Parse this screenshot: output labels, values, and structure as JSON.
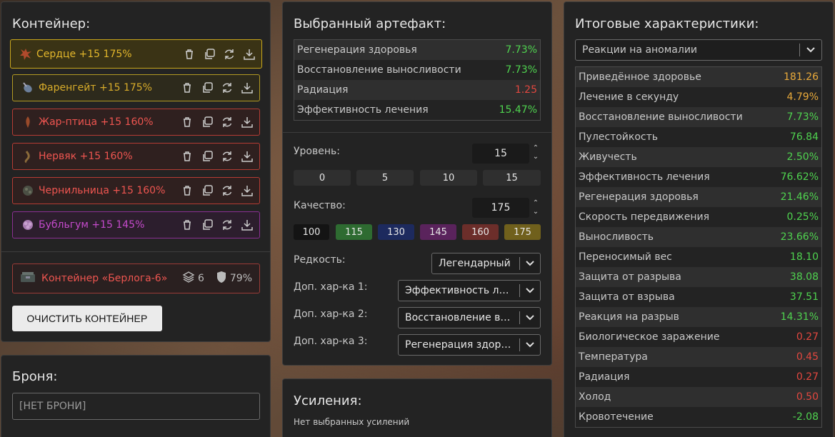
{
  "container": {
    "title": "Контейнер:",
    "items": [
      {
        "name": "Сердце +15 175%",
        "icon": "heart-artifact-icon"
      },
      {
        "name": "Фаренгейт +15 175%",
        "icon": "fahrenheit-artifact-icon"
      },
      {
        "name": "Жар-птица +15 160%",
        "icon": "firebird-artifact-icon"
      },
      {
        "name": "Нервяк +15 160%",
        "icon": "nervyak-artifact-icon"
      },
      {
        "name": "Чернильница +15 160%",
        "icon": "inkwell-artifact-icon"
      },
      {
        "name": "Бубльгум +15 145%",
        "icon": "bubblegum-artifact-icon"
      }
    ],
    "card": {
      "name": "Контейнер «Берлога-6»",
      "slots": "6",
      "protection": "79%"
    },
    "clear_label": "ОЧИСТИТЬ КОНТЕЙНЕР"
  },
  "armor": {
    "title": "Броня:",
    "value": "[НЕТ БРОНИ]"
  },
  "artifact": {
    "title": "Выбранный артефакт:",
    "stats": [
      {
        "label": "Регенерация здоровья",
        "value": "7.73%"
      },
      {
        "label": "Восстановление выносливости",
        "value": "7.73%"
      },
      {
        "label": "Радиация",
        "value": "1.25"
      },
      {
        "label": "Эффективность лечения",
        "value": "15.47%"
      }
    ],
    "level_label": "Уровень:",
    "level_value": "15",
    "level_presets": [
      "0",
      "5",
      "10",
      "15"
    ],
    "quality_label": "Качество:",
    "quality_value": "175",
    "quality_presets": [
      "100",
      "115",
      "130",
      "145",
      "160",
      "175"
    ],
    "rarity_label": "Редкость:",
    "rarity_value": "Легендарный",
    "extra1_label": "Доп. хар-ка 1:",
    "extra1_value": "Эффективность лечения",
    "extra2_label": "Доп. хар-ка 2:",
    "extra2_value": "Восстановление выносливости",
    "extra3_label": "Доп. хар-ка 3:",
    "extra3_value": "Регенерация здоровья"
  },
  "boosts": {
    "title": "Усиления:",
    "empty": "Нет выбранных усилений"
  },
  "final": {
    "title": "Итоговые характеристики:",
    "filter": "Реакции на аномалии",
    "stats": [
      {
        "label": "Приведённое здоровье",
        "value": "181.26"
      },
      {
        "label": "Лечение в секунду",
        "value": "4.79%"
      },
      {
        "label": "Восстановление выносливости",
        "value": "7.73%"
      },
      {
        "label": "Пулестойкость",
        "value": "76.84"
      },
      {
        "label": "Живучесть",
        "value": "2.50%"
      },
      {
        "label": "Эффективность лечения",
        "value": "76.62%"
      },
      {
        "label": "Регенерация здоровья",
        "value": "21.46%"
      },
      {
        "label": "Скорость передвижения",
        "value": "0.25%"
      },
      {
        "label": "Выносливость",
        "value": "23.66%"
      },
      {
        "label": "Переносимый вес",
        "value": "18.10"
      },
      {
        "label": "Защита от разрыва",
        "value": "38.08"
      },
      {
        "label": "Защита от взрыва",
        "value": "37.51"
      },
      {
        "label": "Реакция на разрыв",
        "value": "14.31%"
      },
      {
        "label": "Биологическое заражение",
        "value": "0.27"
      },
      {
        "label": "Температура",
        "value": "0.45"
      },
      {
        "label": "Радиация",
        "value": "0.27"
      },
      {
        "label": "Холод",
        "value": "0.50"
      },
      {
        "label": "Кровотечение",
        "value": "-2.08"
      }
    ]
  },
  "colors": {
    "positive": "#4fd34f",
    "negative": "#e2473f",
    "accent_orange": "#e8a93a"
  }
}
